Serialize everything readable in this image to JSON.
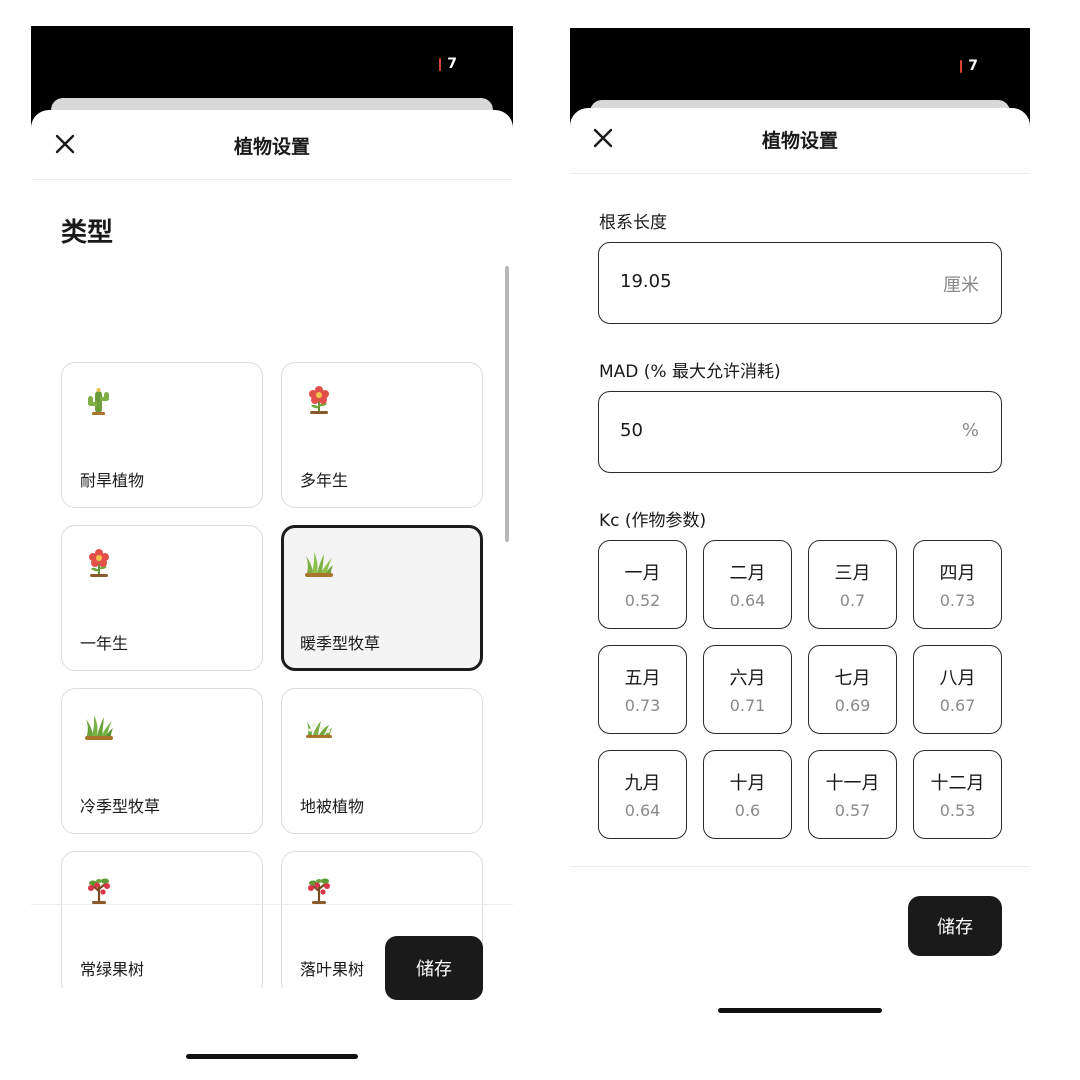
{
  "status_bar": {
    "badge": "7",
    "color_background": "#000000",
    "color_tick": "#d9442e"
  },
  "left_screen": {
    "title": "植物设置",
    "section_heading": "类型",
    "plant_types": [
      {
        "label": "耐旱植物",
        "icon": "cactus-icon",
        "selected": false
      },
      {
        "label": "多年生",
        "icon": "red-flower-icon",
        "selected": false
      },
      {
        "label": "一年生",
        "icon": "red-flower-icon",
        "selected": false
      },
      {
        "label": "暖季型牧草",
        "icon": "grass-icon",
        "selected": true
      },
      {
        "label": "冷季型牧草",
        "icon": "grass-icon",
        "selected": false
      },
      {
        "label": "地被植物",
        "icon": "ground-cover-icon",
        "selected": false
      },
      {
        "label": "常绿果树",
        "icon": "fruit-tree-icon",
        "selected": false
      },
      {
        "label": "落叶果树",
        "icon": "fruit-tree-icon",
        "selected": false
      }
    ],
    "save_label": "储存"
  },
  "right_screen": {
    "title": "植物设置",
    "root_length": {
      "label": "根系长度",
      "value": "19.05",
      "unit": "厘米"
    },
    "mad": {
      "label": "MAD (% 最大允许消耗)",
      "value": "50",
      "unit": "%"
    },
    "kc": {
      "label": "Kc (作物参数)",
      "months": [
        {
          "month": "一月",
          "value": "0.52"
        },
        {
          "month": "二月",
          "value": "0.64"
        },
        {
          "month": "三月",
          "value": "0.7"
        },
        {
          "month": "四月",
          "value": "0.73"
        },
        {
          "month": "五月",
          "value": "0.73"
        },
        {
          "month": "六月",
          "value": "0.71"
        },
        {
          "month": "七月",
          "value": "0.69"
        },
        {
          "month": "八月",
          "value": "0.67"
        },
        {
          "month": "九月",
          "value": "0.64"
        },
        {
          "month": "十月",
          "value": "0.6"
        },
        {
          "month": "十一月",
          "value": "0.57"
        },
        {
          "month": "十二月",
          "value": "0.53"
        }
      ]
    },
    "save_label": "储存"
  },
  "colors": {
    "accent": "#1a1a1a",
    "border_light": "#dcdcdc",
    "muted_text": "#8a8a8a",
    "selected_background": "#f4f4f4"
  }
}
